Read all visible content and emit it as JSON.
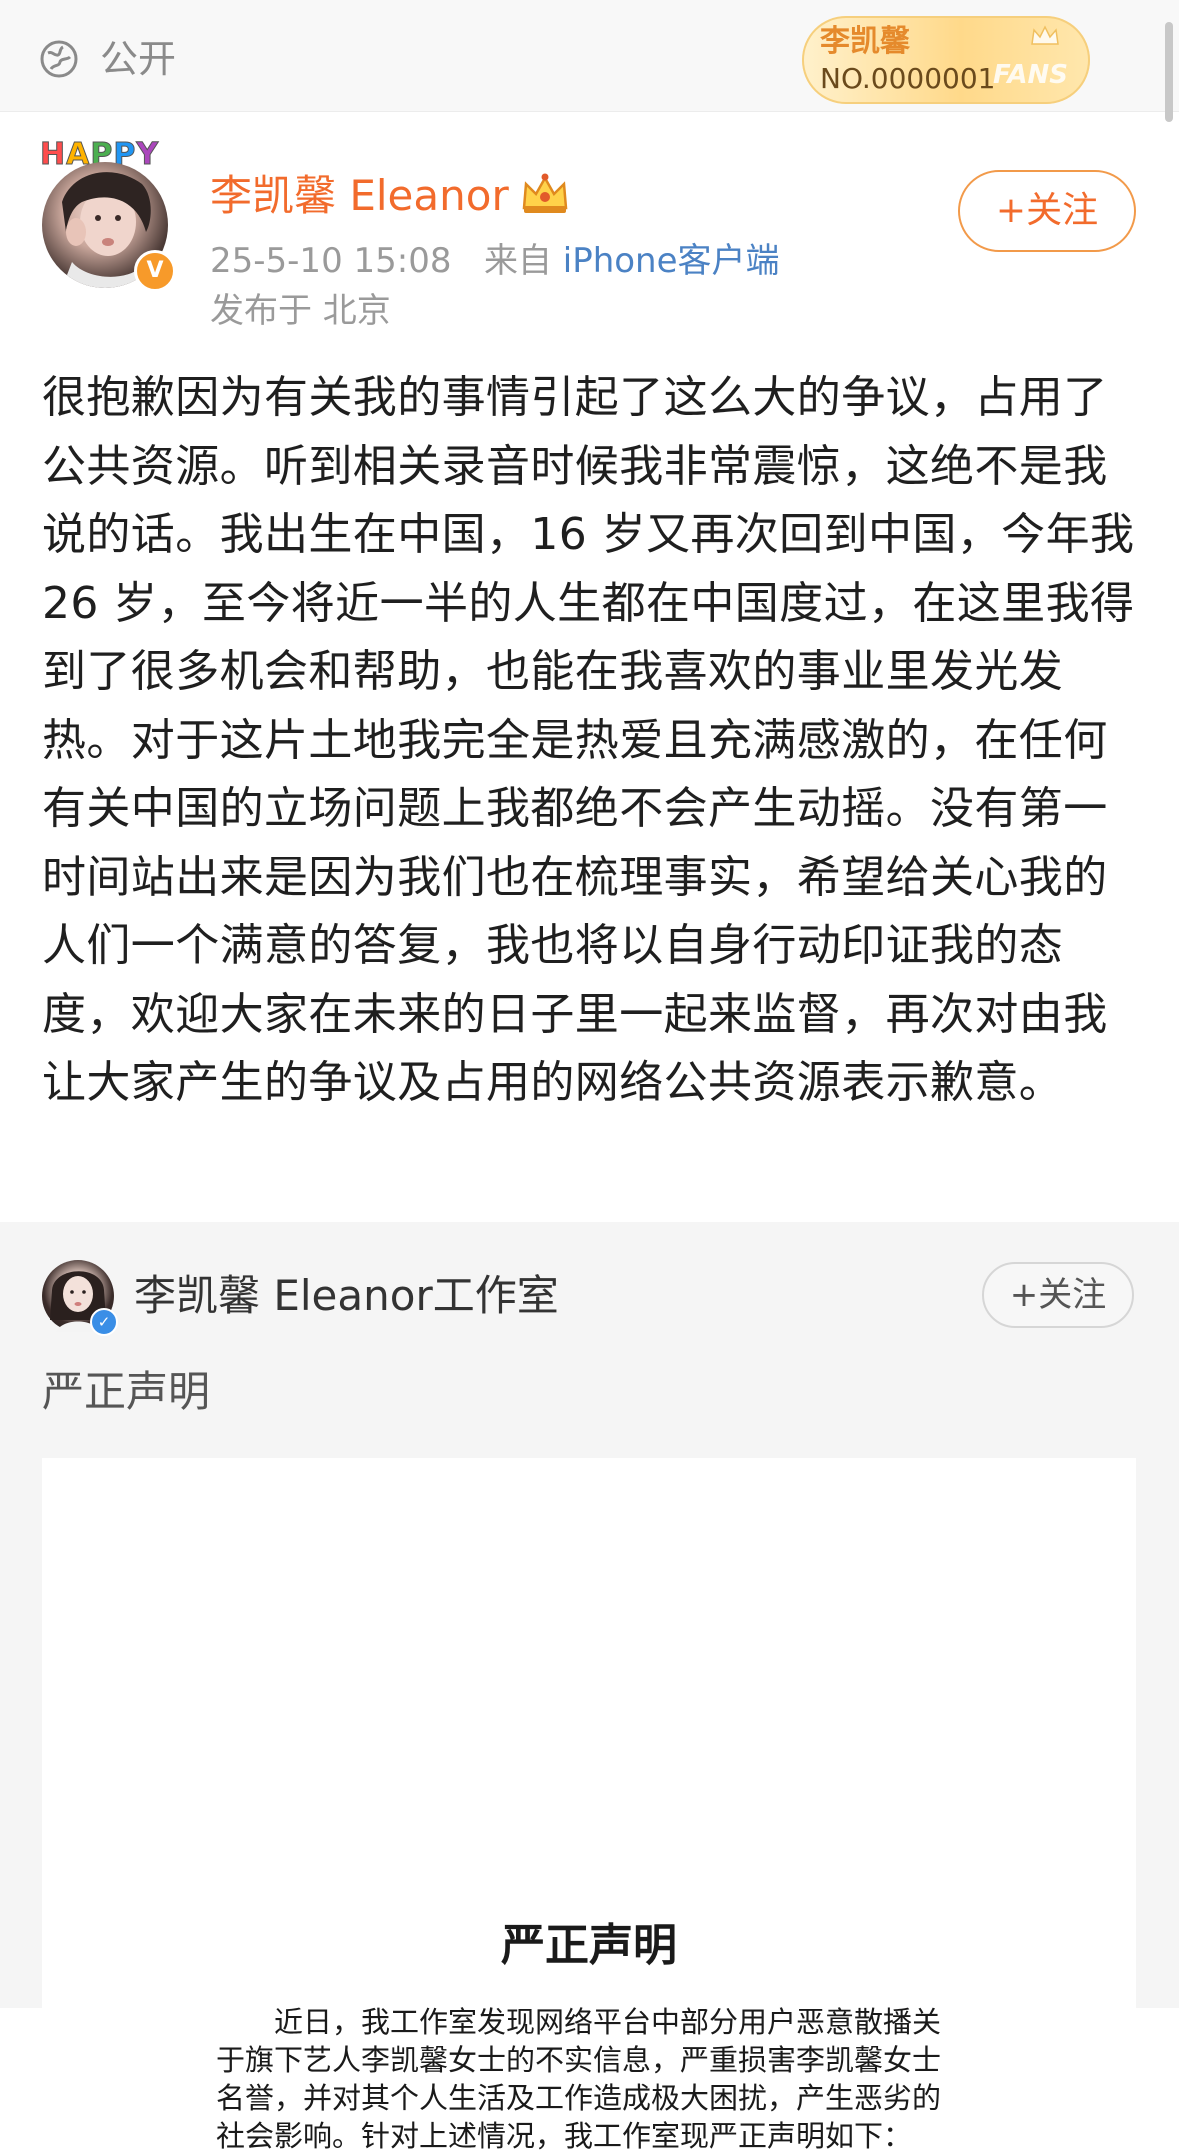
{
  "topbar": {
    "visibility_label": "公开",
    "fans_badge": {
      "name": "李凯馨",
      "number": "NO.0000001",
      "word": "FANS"
    }
  },
  "post": {
    "decoration_text": "HAPPY",
    "author": "李凯馨 Eleanor",
    "time": "25-5-10 15:08",
    "from_prefix": "来自",
    "from_source": "iPhone客户端",
    "location": "发布于 北京",
    "follow_label": "+关注",
    "body": "很抱歉因为有关我的事情引起了这么大的争议，占用了公共资源。听到相关录音时候我非常震惊，这绝不是我说的话。我出生在中国，16 岁又再次回到中国，今年我 26 岁，至今将近一半的人生都在中国度过，在这里我得到了很多机会和帮助，也能在我喜欢的事业里发光发热。对于这片土地我完全是热爱且充满感激的，在任何有关中国的立场问题上我都绝不会产生动摇。没有第一时间站出来是因为我们也在梳理事实，希望给关心我的人们一个满意的答复，我也将以自身行动印证我的态度，欢迎大家在未来的日子里一起来监督，再次对由我让大家产生的争议及占用的网络公共资源表示歉意。"
  },
  "repost": {
    "author": "李凯馨 Eleanor工作室",
    "follow_label": "+关注",
    "title": "严正声明",
    "document": {
      "heading": "严正声明",
      "body": "近日，我工作室发现网络平台中部分用户恶意散播关于旗下艺人李凯馨女士的不实信息，严重损害李凯馨女士名誉，并对其个人生活及工作造成极大困扰，产生恶劣的社会影响。针对上述情况，我工作室现严正声明如下："
    }
  },
  "colors": {
    "accent_orange": "#f26b2c",
    "link_blue": "#4b82c4",
    "verified_orange": "#f79a2a",
    "verified_blue": "#3a8ee6"
  }
}
